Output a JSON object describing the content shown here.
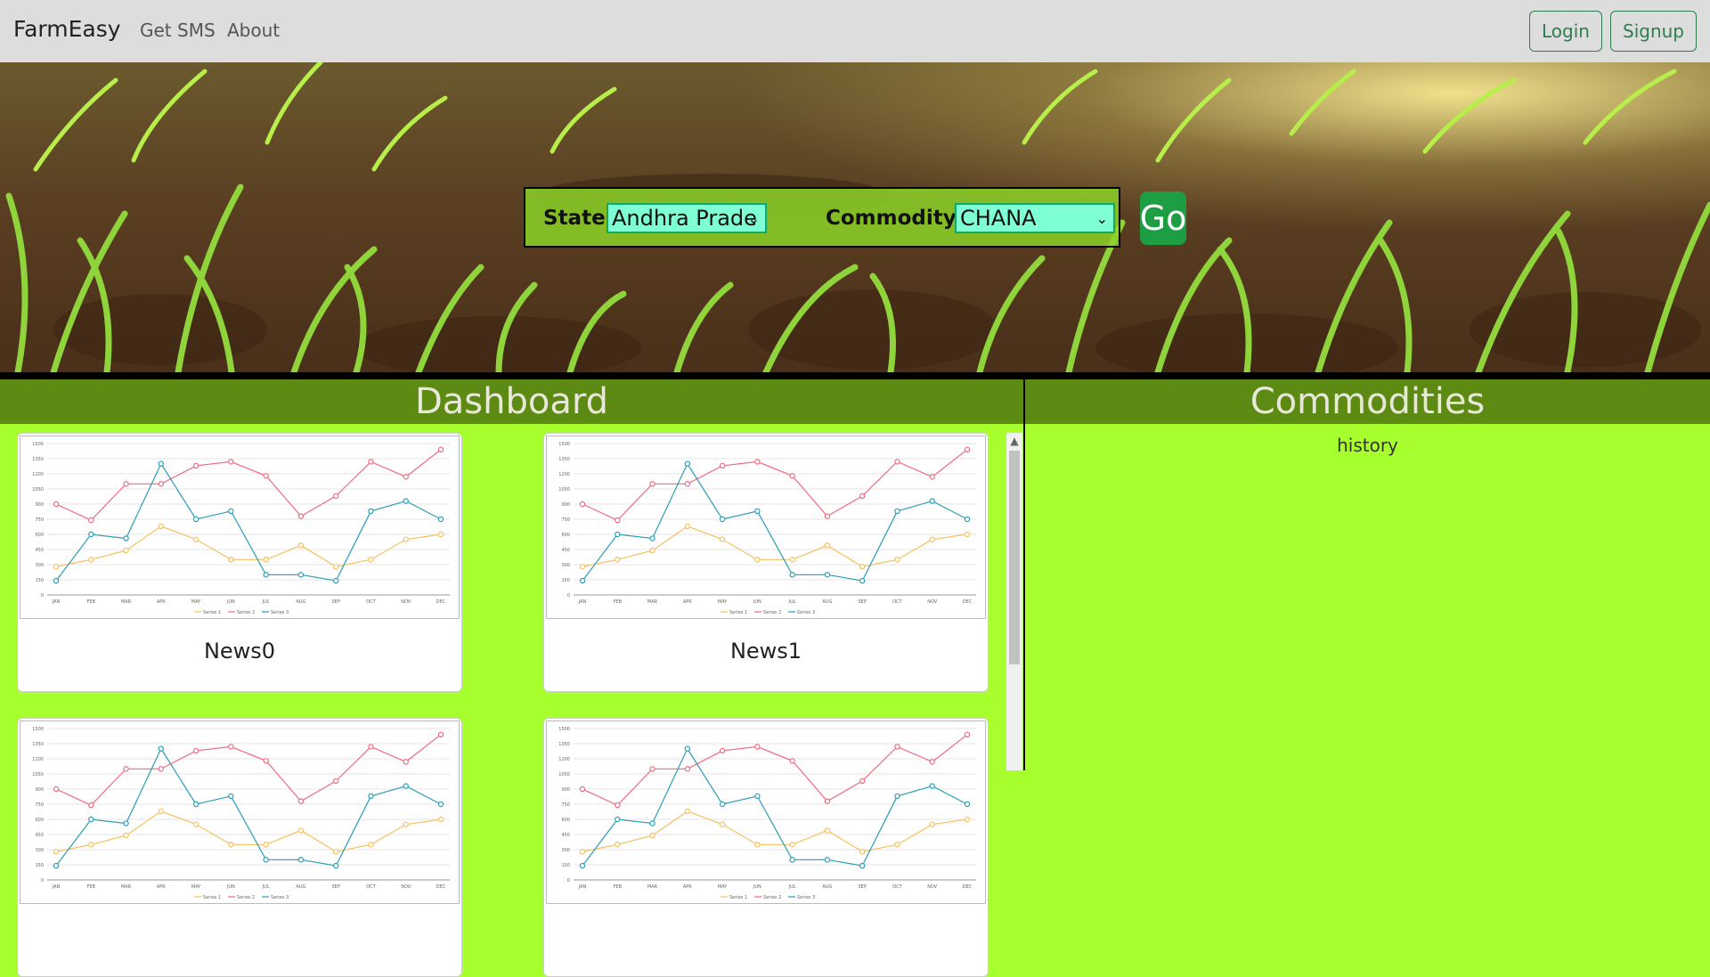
{
  "navbar": {
    "brand": "FarmEasy",
    "links": [
      "Get SMS",
      "About"
    ],
    "login": "Login",
    "signup": "Signup"
  },
  "filters": {
    "state_label": "State:",
    "state_value": "Andhra Prade",
    "commodity_label": "Commodity:",
    "commodity_value": "CHANA",
    "go_label": "Go"
  },
  "dashboard": {
    "title": "Dashboard",
    "cards": [
      {
        "title": "News0"
      },
      {
        "title": "News1"
      },
      {
        "title": ""
      },
      {
        "title": ""
      }
    ]
  },
  "commodities": {
    "title": "Commodities",
    "history": "history"
  },
  "chart_data": {
    "type": "line",
    "categories": [
      "JAN",
      "FEB",
      "MAR",
      "APR",
      "MAY",
      "JUN",
      "JUL",
      "AUG",
      "SEP",
      "OCT",
      "NOV",
      "DEC"
    ],
    "ylim": [
      0,
      1500
    ],
    "yticks": [
      "0",
      "150",
      "300",
      "450",
      "600",
      "750",
      "900",
      "1050",
      "1200",
      "1350",
      "1500"
    ],
    "series": [
      {
        "name": "Series 1",
        "color": "#f5c060",
        "values": [
          280,
          350,
          440,
          680,
          550,
          350,
          350,
          490,
          280,
          350,
          550,
          600
        ]
      },
      {
        "name": "Series 2",
        "color": "#f06a80",
        "values": [
          900,
          740,
          1100,
          1100,
          1280,
          1320,
          1180,
          780,
          980,
          1320,
          1170,
          1440
        ]
      },
      {
        "name": "Series 3",
        "color": "#2a9db8",
        "values": [
          140,
          600,
          560,
          1300,
          750,
          830,
          200,
          200,
          140,
          830,
          930,
          750
        ]
      }
    ]
  }
}
